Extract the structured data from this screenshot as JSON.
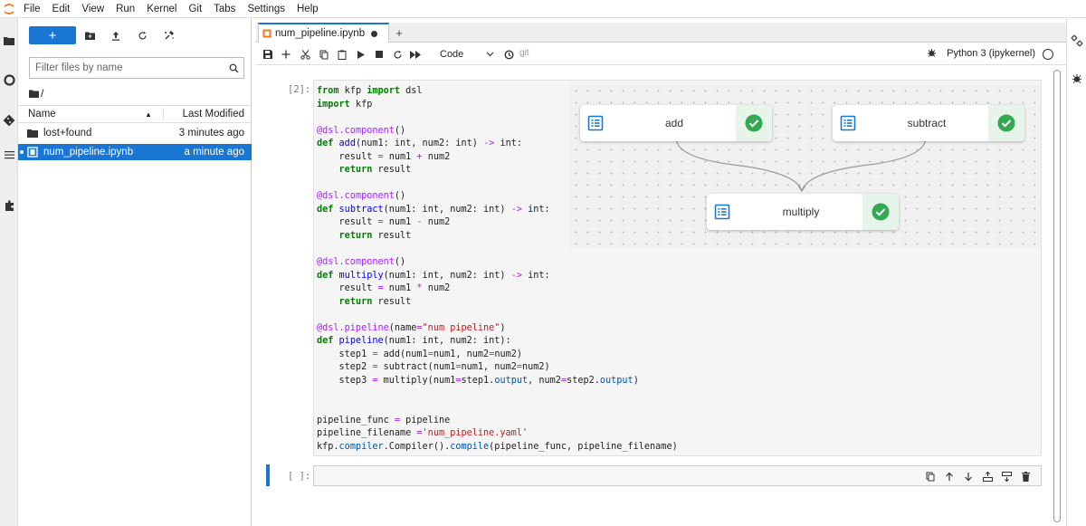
{
  "menubar": {
    "items": [
      "File",
      "Edit",
      "View",
      "Run",
      "Kernel",
      "Git",
      "Tabs",
      "Settings",
      "Help"
    ]
  },
  "filebrowser": {
    "new_label": "+",
    "filter": {
      "placeholder": "Filter files by name",
      "value": ""
    },
    "breadcrumb": "/",
    "columns": {
      "name": "Name",
      "modified": "Last Modified"
    },
    "files": [
      {
        "name": "lost+found",
        "modified": "3 minutes ago",
        "type": "folder",
        "selected": false
      },
      {
        "name": "num_pipeline.ipynb",
        "modified": "a minute ago",
        "type": "notebook",
        "selected": true
      }
    ]
  },
  "tab": {
    "label": "num_pipeline.ipynb",
    "add": "+"
  },
  "toolbar": {
    "cell_type": "Code",
    "git": "git",
    "kernel": "Python 3 (ipykernel)"
  },
  "cells": [
    {
      "prompt": "[2]:"
    },
    {
      "prompt": "[ ]:"
    }
  ],
  "graph": {
    "nodes": [
      {
        "label": "add",
        "status": "succeeded"
      },
      {
        "label": "subtract",
        "status": "succeeded"
      },
      {
        "label": "multiply",
        "status": "succeeded"
      }
    ]
  },
  "colors": {
    "accent": "#1976d2",
    "success": "#34a853",
    "success_bg": "#e6f4ea"
  }
}
